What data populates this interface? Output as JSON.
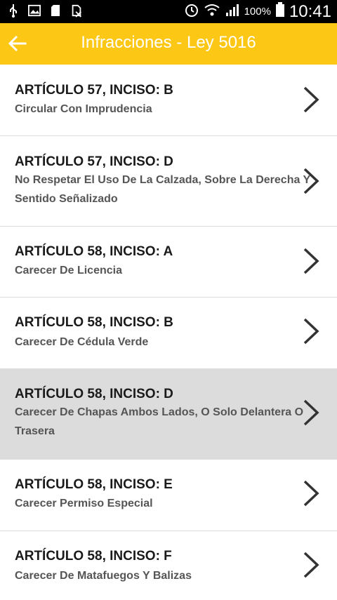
{
  "status_bar": {
    "battery_percent": "100%",
    "time": "10:41",
    "icons": [
      "usb-icon",
      "image-icon",
      "sd-card-icon",
      "no-sim-icon",
      "alarm-icon",
      "wifi-icon",
      "signal-icon",
      "battery-icon"
    ]
  },
  "app_bar": {
    "back_icon": "arrow-left-icon",
    "title": "Infracciones - Ley 5016",
    "background": "#fdc716"
  },
  "list": {
    "items": [
      {
        "title": "ARTÍCULO 57, INCISO: B",
        "subtitle": "Circular Con Imprudencia",
        "selected": false
      },
      {
        "title": "ARTÍCULO 57, INCISO: D",
        "subtitle": "No Respetar El Uso De La Calzada, Sobre La Derecha Y Sentido Señalizado",
        "selected": false
      },
      {
        "title": "ARTÍCULO 58, INCISO: A",
        "subtitle": "Carecer De Licencia",
        "selected": false
      },
      {
        "title": "ARTÍCULO 58, INCISO: B",
        "subtitle": "Carecer De Cédula Verde",
        "selected": false
      },
      {
        "title": "ARTÍCULO 58, INCISO: D",
        "subtitle": "Carecer De Chapas Ambos Lados, O Solo Delantera O Trasera",
        "selected": true
      },
      {
        "title": "ARTÍCULO 58, INCISO: E",
        "subtitle": "Carecer Permiso Especial",
        "selected": false
      },
      {
        "title": "ARTÍCULO 58, INCISO: F",
        "subtitle": "Carecer De Matafuegos Y Balizas",
        "selected": false
      }
    ],
    "chevron_icon": "chevron-right-icon"
  }
}
